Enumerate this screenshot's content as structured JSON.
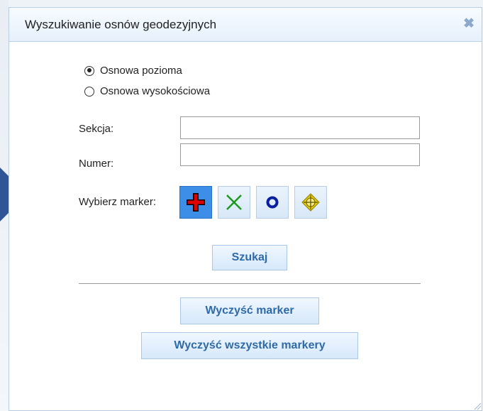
{
  "dialog": {
    "title": "Wyszukiwanie osnów geodezyjnych",
    "close_glyph": "✖"
  },
  "radios": [
    {
      "label": "Osnowa pozioma",
      "checked": true
    },
    {
      "label": "Osnowa wysokościowa",
      "checked": false
    }
  ],
  "fields": {
    "sekcja_label": "Sekcja:",
    "sekcja_value": "",
    "numer_label": "Numer:",
    "numer_value": ""
  },
  "marker": {
    "label": "Wybierz marker:",
    "options": [
      {
        "icon": "red-cross-icon",
        "color": "#e00000",
        "selected": true
      },
      {
        "icon": "green-x-icon",
        "color": "#1a9a1a",
        "selected": false
      },
      {
        "icon": "blue-ring-icon",
        "color": "#0a1ea0",
        "selected": false
      },
      {
        "icon": "yellow-target-icon",
        "color": "#e8cf00",
        "selected": false
      }
    ]
  },
  "buttons": {
    "search": "Szukaj",
    "clear_marker": "Wyczyść marker",
    "clear_all": "Wyczyść wszystkie markery"
  },
  "colors": {
    "accent": "#2e6aa8",
    "selected_marker_bg": "#3d8ee6",
    "side_arrow": "#2f5597"
  }
}
